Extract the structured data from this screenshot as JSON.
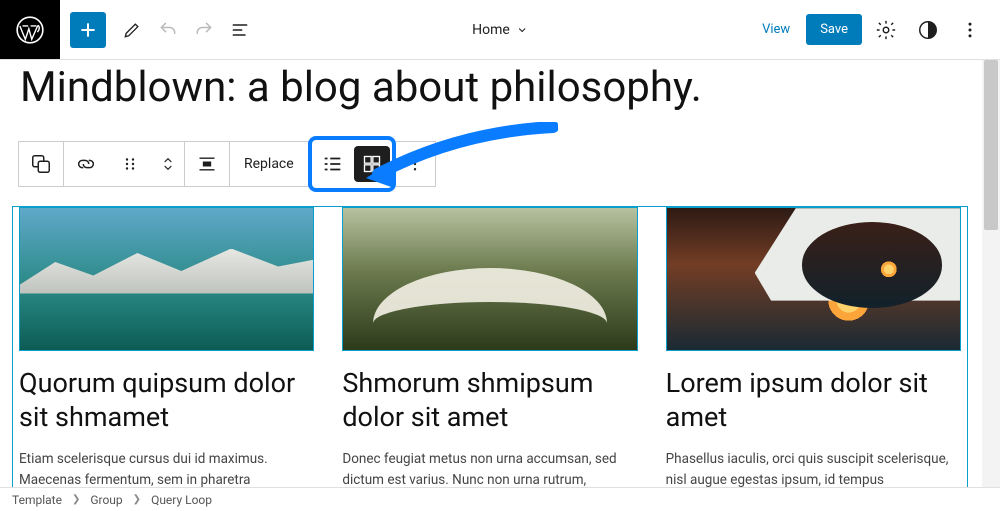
{
  "topbar": {
    "doc_title": "Home",
    "view_label": "View",
    "save_label": "Save"
  },
  "page": {
    "title": "Mindblown: a blog about philosophy."
  },
  "block_toolbar": {
    "replace_label": "Replace"
  },
  "posts": [
    {
      "title": "Quorum quipsum dolor sit shmamet",
      "excerpt": "Etiam scelerisque cursus dui id maximus. Maecenas fermentum, sem in pharetra pellentesque, velit turpis habitant"
    },
    {
      "title": "Shmorum shmipsum dolor sit amet",
      "excerpt": "Donec feugiat metus non urna accumsan, sed dictum est varius. Nunc non urna rutrum, rhoncus eros eget, dapibus"
    },
    {
      "title": "Lorem ipsum dolor sit amet",
      "excerpt": "Phasellus iaculis, orci quis suscipit scelerisque, nisl augue egestas ipsum, id tempus"
    }
  ],
  "breadcrumb": {
    "items": [
      "Template",
      "Group",
      "Query Loop"
    ]
  }
}
